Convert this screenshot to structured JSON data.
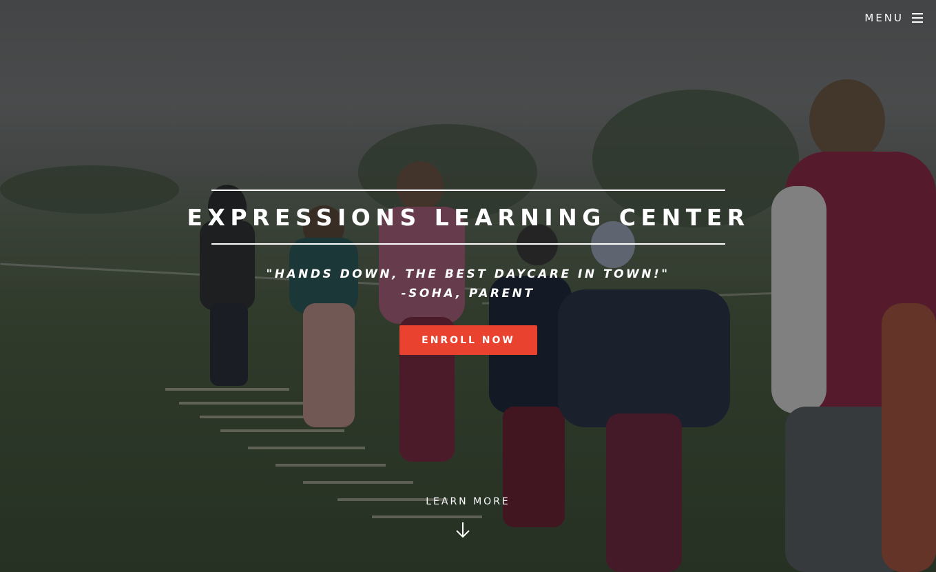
{
  "menu": {
    "label": "MENU",
    "icon": "hamburger-icon"
  },
  "hero": {
    "title": "EXPRESSIONS LEARNING CENTER",
    "quote_line1": "\"HANDS DOWN, THE BEST DAYCARE IN TOWN!\"",
    "quote_line2": "-SOHA, PARENT",
    "cta_label": "ENROLL NOW",
    "learn_more_label": "LEARN MORE",
    "learn_more_icon": "arrow-down-icon"
  },
  "colors": {
    "cta": "#e9432f",
    "text": "#ffffff",
    "overlay": "rgba(0,0,0,0.38)"
  }
}
